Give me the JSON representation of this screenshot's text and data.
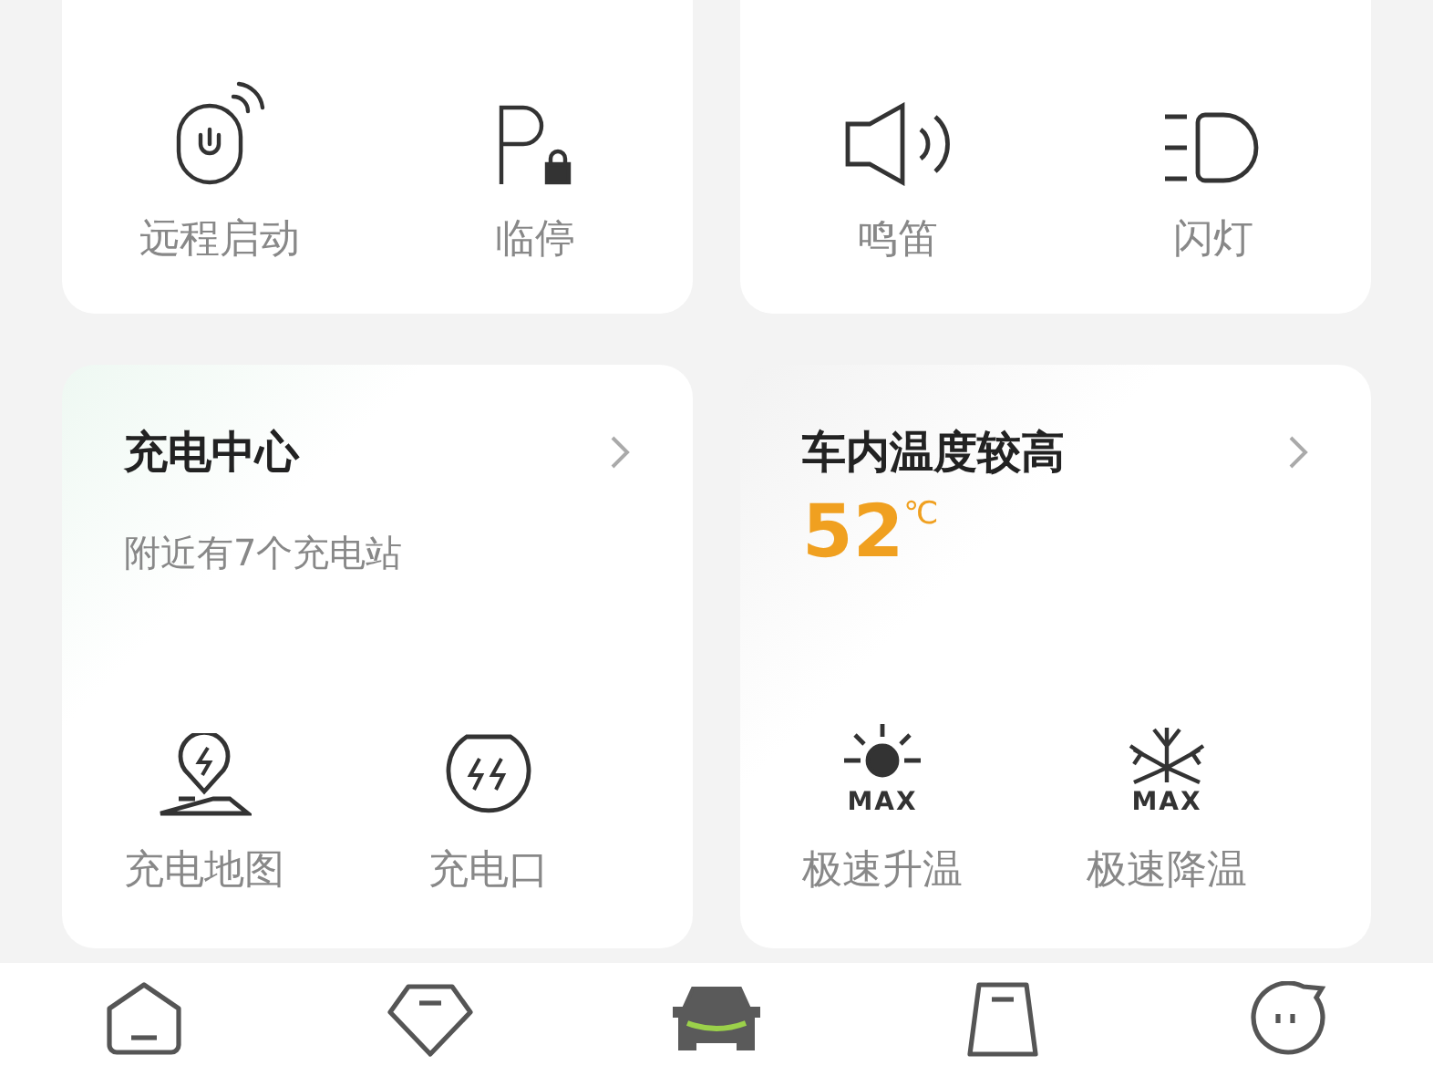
{
  "quick_controls": [
    {
      "actions": [
        {
          "kind": "remote-start",
          "label": "远程启动"
        },
        {
          "kind": "parking",
          "label": "临停"
        }
      ]
    },
    {
      "actions": [
        {
          "kind": "horn",
          "label": "鸣笛"
        },
        {
          "kind": "light",
          "label": "闪灯"
        }
      ]
    }
  ],
  "cards": [
    {
      "kind": "charging",
      "title": "充电中心",
      "subtitle": "附近有7个充电站",
      "actions": [
        {
          "kind": "charge-map",
          "label": "充电地图"
        },
        {
          "kind": "charge-port",
          "label": "充电口"
        }
      ]
    },
    {
      "kind": "climate",
      "title": "车内温度较高",
      "temperature": "52",
      "unit": "℃",
      "actions": [
        {
          "kind": "heat-max",
          "badge": "MAX",
          "label": "极速升温"
        },
        {
          "kind": "cool-max",
          "badge": "MAX",
          "label": "极速降温"
        }
      ]
    }
  ],
  "bottom_nav": [
    {
      "kind": "home",
      "selected": false
    },
    {
      "kind": "diamond",
      "selected": false
    },
    {
      "kind": "car",
      "selected": true
    },
    {
      "kind": "bag",
      "selected": false
    },
    {
      "kind": "chat",
      "selected": false
    }
  ]
}
